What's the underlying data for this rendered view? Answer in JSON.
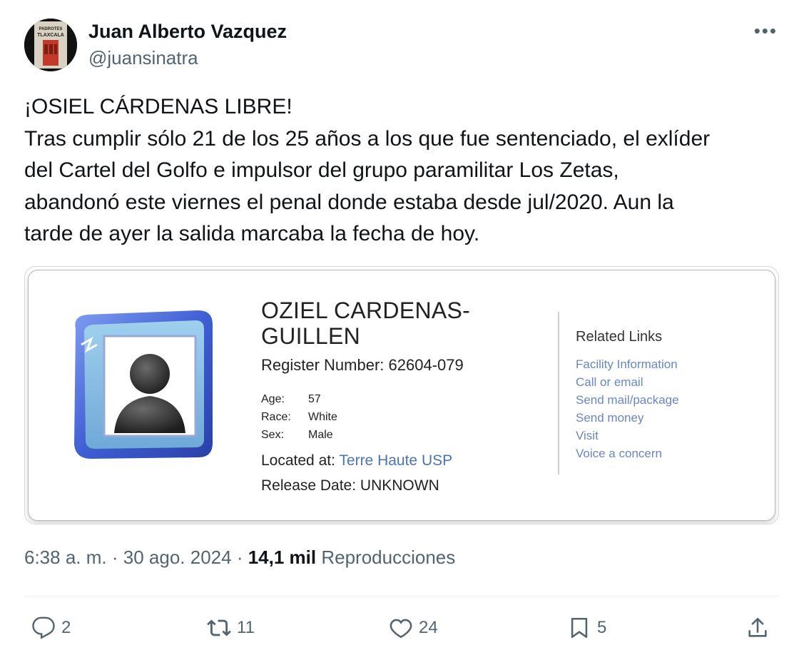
{
  "author": {
    "name": "Juan Alberto Vazquez",
    "handle": "@juansinatra",
    "avatar_text": "LOS PADROTES DE TLAXCALA"
  },
  "tweet": {
    "lines": [
      "¡OSIEL CÁRDENAS LIBRE!",
      "Tras cumplir sólo 21 de los 25 años a los que fue sentenciado, el exlíder",
      "del Cartel del Golfo e impulsor del grupo paramilitar Los Zetas,",
      "abandonó este viernes el penal donde estaba desde jul/2020. Aun la",
      "tarde de ayer la salida marcaba la fecha de hoy."
    ]
  },
  "card": {
    "name_line1": "OZIEL CARDENAS-",
    "name_line2": "GUILLEN",
    "register": "Register Number: 62604-079",
    "age_label": "Age:",
    "age": "57",
    "race_label": "Race:",
    "race": "White",
    "sex_label": "Sex:",
    "sex": "Male",
    "located_label": "Located at:",
    "located_value": "Terre Haute USP",
    "release": "Release Date: UNKNOWN",
    "related_title": "Related Links",
    "links": [
      "Facility Information",
      "Call or email",
      "Send mail/package",
      "Send money",
      "Visit",
      "Voice a concern"
    ]
  },
  "meta": {
    "time": "6:38 a. m.",
    "dot1": "·",
    "date": "30 ago. 2024",
    "dot2": "·",
    "views": "14,1 mil",
    "views_label": "Reproducciones"
  },
  "actions": {
    "replies": "2",
    "retweets": "11",
    "likes": "24",
    "bookmarks": "5"
  },
  "icons": [
    "more-icon",
    "reply-icon",
    "retweet-icon",
    "like-icon",
    "bookmark-icon",
    "share-icon"
  ],
  "colors": {
    "link": "#6a86c2",
    "muted": "#536471",
    "text": "#0f1419"
  }
}
